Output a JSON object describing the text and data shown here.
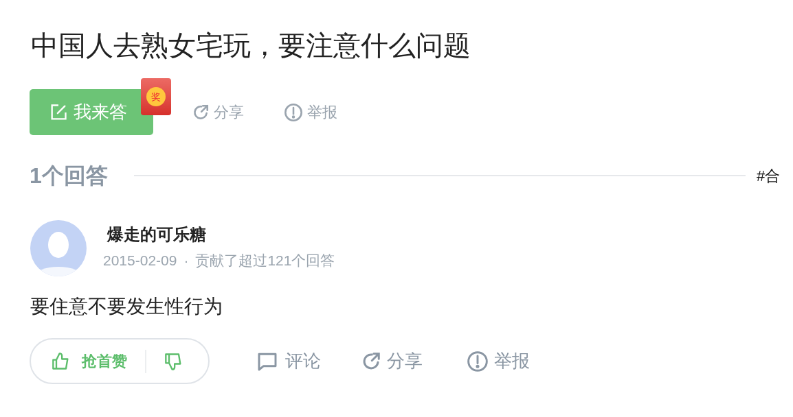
{
  "question": {
    "title": "中国人去熟女宅玩，要注意什么问题"
  },
  "actions": {
    "answer_button": "我来答",
    "reward_badge": "奖",
    "share": "分享",
    "report": "举报"
  },
  "answers_header": {
    "count": "1个回答",
    "tag": "#合"
  },
  "answers": [
    {
      "author": "爆走的可乐糖",
      "date": "2015-02-09",
      "dot": "·",
      "contribution": "贡献了超过121个回答",
      "content": "要住意不要发生性行为",
      "like": "抢首赞",
      "comment": "评论",
      "share": "分享",
      "report": "举报"
    }
  ]
}
